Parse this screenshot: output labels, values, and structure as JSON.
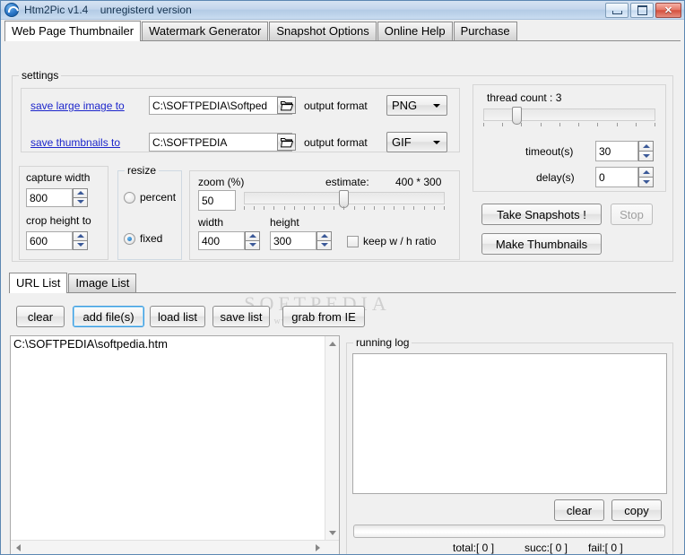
{
  "window": {
    "title": "Htm2Pic v1.4    unregisterd version",
    "icon": "app-globe-icon",
    "buttons": {
      "minimize": "minimize-icon",
      "maximize": "maximize-icon",
      "close": "✕"
    }
  },
  "tabs": [
    {
      "label": "Web Page Thumbnailer",
      "active": true
    },
    {
      "label": "Watermark Generator",
      "active": false
    },
    {
      "label": "Snapshot Options",
      "active": false
    },
    {
      "label": "Online Help",
      "active": false
    },
    {
      "label": "Purchase",
      "active": false
    }
  ],
  "settings": {
    "title": "settings",
    "large_image": {
      "link_label": "save large image to",
      "path_value": "C:\\SOFTPEDIA\\Softped",
      "browse_icon": "open-folder-icon",
      "format_label": "output format",
      "format_value": "PNG"
    },
    "thumbnails": {
      "link_label": "save thumbnails to",
      "path_value": "C:\\SOFTPEDIA",
      "browse_icon": "open-folder-icon",
      "format_label": "output format",
      "format_value": "GIF"
    }
  },
  "capture": {
    "width_label": "capture width",
    "width_value": "800",
    "height_label": "crop height to",
    "height_value": "600"
  },
  "resize": {
    "title": "resize",
    "options": [
      {
        "label": "percent",
        "checked": false
      },
      {
        "label": "fixed",
        "checked": true
      }
    ]
  },
  "zoom_panel": {
    "zoom_label": "zoom (%)",
    "zoom_value": "50",
    "estimate_label": "estimate:",
    "estimate_value": "400 * 300",
    "slider_percent": 50,
    "width_label": "width",
    "width_value": "400",
    "height_label": "height",
    "height_value": "300",
    "keep_ratio_label": "keep w / h ratio",
    "keep_ratio_checked": false
  },
  "threads": {
    "thread_count_label": "thread count : 3",
    "thread_slider_percent": 17,
    "timeout_label": "timeout(s)",
    "timeout_value": "30",
    "delay_label": "delay(s)",
    "delay_value": "0"
  },
  "actions": {
    "take_snapshots": "Take Snapshots !",
    "stop": "Stop",
    "stop_disabled": true,
    "make_thumbnails": "Make Thumbnails"
  },
  "list_tabs": [
    {
      "label": "URL List",
      "active": true
    },
    {
      "label": "Image List",
      "active": false
    }
  ],
  "list_toolbar": [
    {
      "label": "clear",
      "focused": false
    },
    {
      "label": "add file(s)",
      "focused": true
    },
    {
      "label": "load list",
      "focused": false
    },
    {
      "label": "save list",
      "focused": false
    },
    {
      "label": "grab from IE",
      "focused": false
    }
  ],
  "url_list": {
    "items": [
      "C:\\SOFTPEDIA\\softpedia.htm"
    ]
  },
  "running_log": {
    "title": "running log",
    "content": "",
    "clear_label": "clear",
    "copy_label": "copy",
    "progress_percent": 0,
    "status": {
      "total": "total:[ 0 ]",
      "succ": "succ:[ 0 ]",
      "fail": "fail:[ 0 ]"
    }
  },
  "watermark": {
    "line1": "SOFTPEDIA",
    "line2": "www.softpedia.com"
  }
}
